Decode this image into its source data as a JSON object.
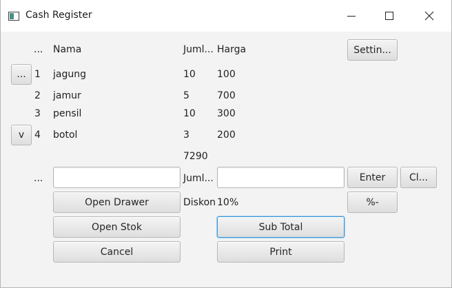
{
  "window": {
    "title": "Cash Register",
    "controls": {
      "minimize": "minimize-icon",
      "maximize": "maximize-icon",
      "close": "close-icon"
    }
  },
  "header": {
    "col_no": "...",
    "col_name": "Nama",
    "col_qty": "Juml...",
    "col_price": "Harga",
    "settings_label": "Settin..."
  },
  "side_buttons": {
    "up_label": "...",
    "down_label": "v"
  },
  "items": [
    {
      "no": "1",
      "name": "jagung",
      "qty": "10",
      "price": "100"
    },
    {
      "no": "2",
      "name": "jamur",
      "qty": "5",
      "price": "700"
    },
    {
      "no": "3",
      "name": "pensil",
      "qty": "10",
      "price": "300"
    },
    {
      "no": "4",
      "name": "botol",
      "qty": "3",
      "price": "200"
    }
  ],
  "total": "7290",
  "entry": {
    "row_marker": "...",
    "name_value": "",
    "qty_label": "Juml...",
    "qty_value": "",
    "enter_label": "Enter",
    "clear_label": "Cl..."
  },
  "discount": {
    "label": "Diskon",
    "value": "10%",
    "button_label": "%-"
  },
  "actions": {
    "open_drawer": "Open Drawer",
    "open_stok": "Open Stok",
    "cancel": "Cancel",
    "sub_total": "Sub Total",
    "print": "Print"
  },
  "colors": {
    "window_bg": "#f3f3f3",
    "titlebar_bg": "#ffffff",
    "focus_border": "#3a97d6",
    "icon_accent": "#4a8f83"
  }
}
